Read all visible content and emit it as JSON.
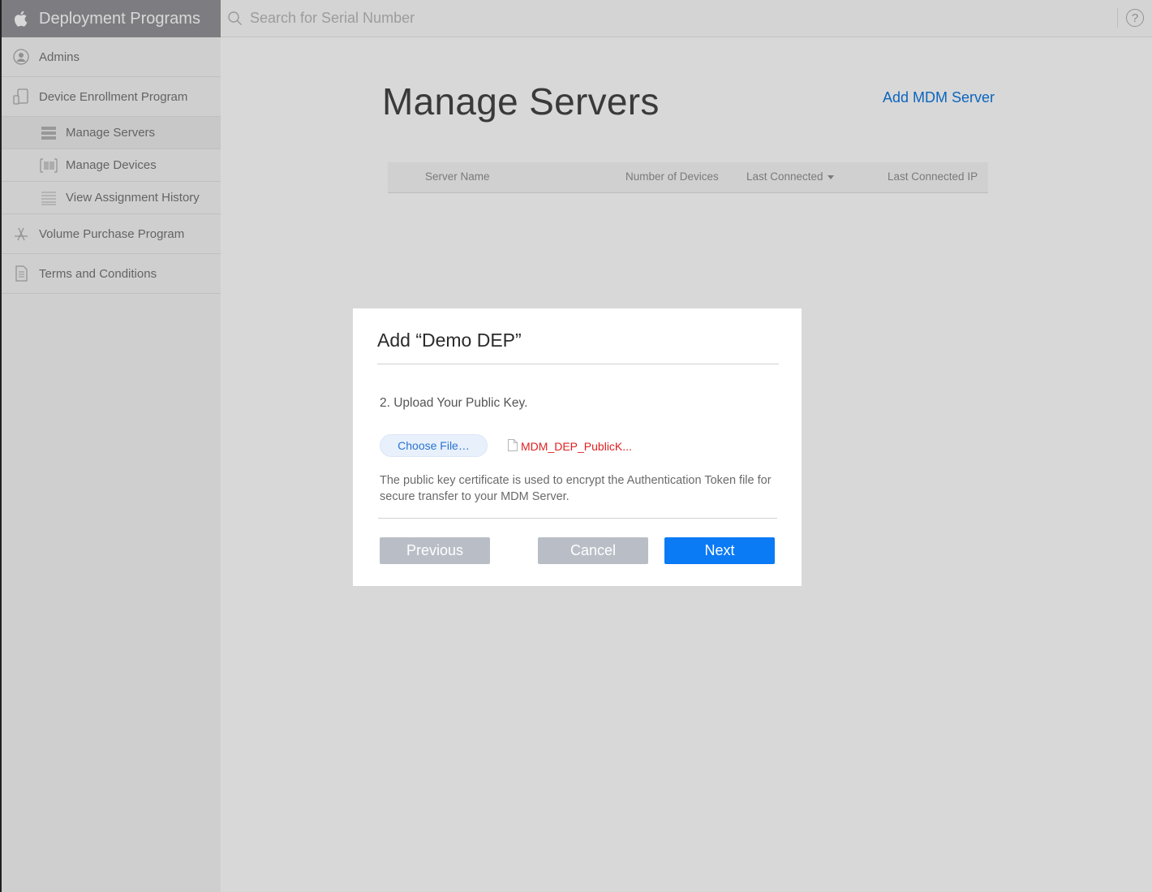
{
  "sidebar": {
    "title": "Deployment Programs",
    "items": [
      {
        "label": "Admins",
        "icon": "user-circle-icon"
      },
      {
        "label": "Device Enrollment Program",
        "icon": "devices-icon"
      },
      {
        "label": "Volume Purchase Program",
        "icon": "app-store-icon"
      },
      {
        "label": "Terms and Conditions",
        "icon": "document-icon"
      }
    ],
    "subitems": [
      {
        "label": "Manage Servers",
        "icon": "server-icon",
        "active": true
      },
      {
        "label": "Manage Devices",
        "icon": "barcode-icon"
      },
      {
        "label": "View Assignment History",
        "icon": "list-icon"
      }
    ]
  },
  "search": {
    "placeholder": "Search for Serial Number"
  },
  "help": {
    "glyph": "?"
  },
  "main": {
    "title": "Manage Servers",
    "add_link": "Add MDM Server",
    "table_headers": [
      "Server Name",
      "Number of Devices",
      "Last Connected",
      "Last Connected IP"
    ]
  },
  "modal": {
    "title": "Add “Demo DEP”",
    "step": "2. Upload Your Public Key.",
    "choose_file": "Choose File…",
    "file_name": "MDM_DEP_PublicK...",
    "help_text": "The public key certificate is used to encrypt the Authentication Token file for secure transfer to your MDM Server.",
    "buttons": {
      "previous": "Previous",
      "cancel": "Cancel",
      "next": "Next"
    }
  },
  "colors": {
    "accent": "#0a7af5",
    "link": "#0070e0",
    "error": "#e02020",
    "disabled": "#b9bec6"
  }
}
